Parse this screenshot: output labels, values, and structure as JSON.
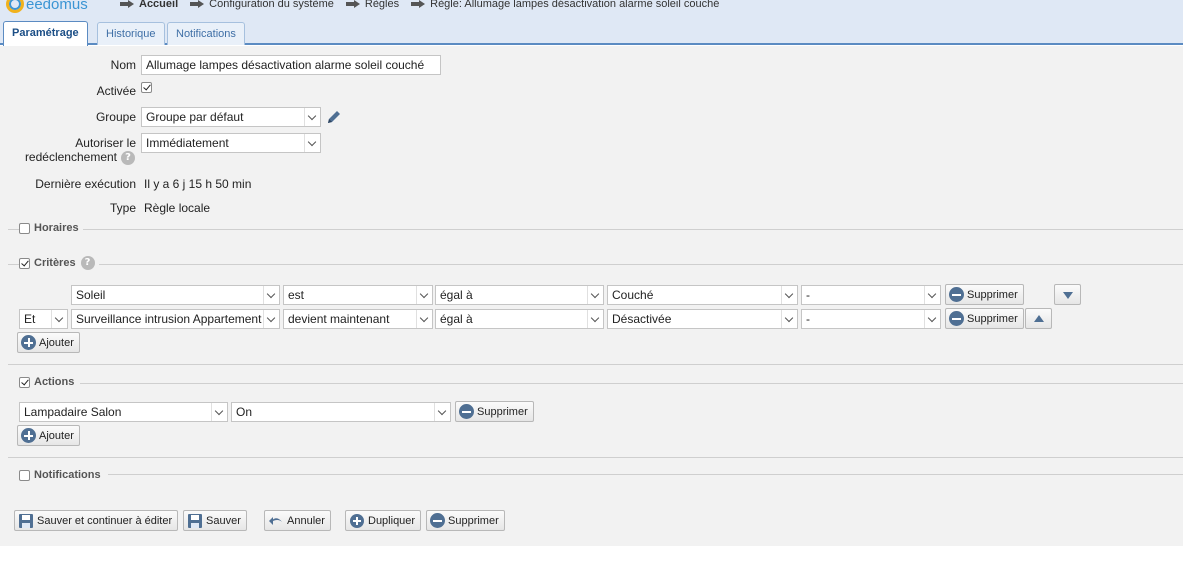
{
  "app": {
    "logo_text": "eedomus"
  },
  "breadcrumb": [
    {
      "label": "Accueil",
      "bold": true
    },
    {
      "label": "Configuration du système"
    },
    {
      "label": "Règles"
    },
    {
      "label": "Règle: Allumage lampes désactivation alarme soleil couché"
    }
  ],
  "tabs": [
    {
      "label": "Paramétrage",
      "active": true
    },
    {
      "label": "Historique"
    },
    {
      "label": "Notifications"
    }
  ],
  "form": {
    "nom_label": "Nom",
    "nom_value": "Allumage lampes désactivation alarme soleil couché",
    "activee_label": "Activée",
    "activee_checked": true,
    "groupe_label": "Groupe",
    "groupe_value": "Groupe par défaut",
    "autoriser_label_1": "Autoriser le",
    "autoriser_label_2": "redéclenchement",
    "autoriser_value": "Immédiatement",
    "derniere_label": "Dernière exécution",
    "derniere_value": "Il y a 6 j 15 h 50 min",
    "type_label": "Type",
    "type_value": "Règle locale"
  },
  "sections": {
    "horaires": {
      "label": "Horaires",
      "checked": false
    },
    "criteres": {
      "label": "Critères",
      "checked": true
    },
    "actions": {
      "label": "Actions",
      "checked": true
    },
    "notifications": {
      "label": "Notifications",
      "checked": false
    }
  },
  "criteria": [
    {
      "connector": "",
      "device": "Soleil",
      "verb": "est",
      "operator": "égal à",
      "value": "Couché",
      "extra": "-",
      "delete_label": "Supprimer"
    },
    {
      "connector": "Et",
      "device": "Surveillance intrusion Appartement",
      "verb": "devient maintenant",
      "operator": "égal à",
      "value": "Désactivée",
      "extra": "-",
      "delete_label": "Supprimer"
    }
  ],
  "criteria_add_label": "Ajouter",
  "actions": [
    {
      "device": "Lampadaire Salon",
      "value": "On",
      "delete_label": "Supprimer"
    }
  ],
  "actions_add_label": "Ajouter",
  "footer": {
    "save_continue": "Sauver et continuer à éditer",
    "save": "Sauver",
    "cancel": "Annuler",
    "duplicate": "Dupliquer",
    "delete": "Supprimer"
  },
  "colors": {
    "accent": "#4f6f93",
    "tab_bar": "#dfe8f5",
    "panel": "#f2f2f2"
  }
}
